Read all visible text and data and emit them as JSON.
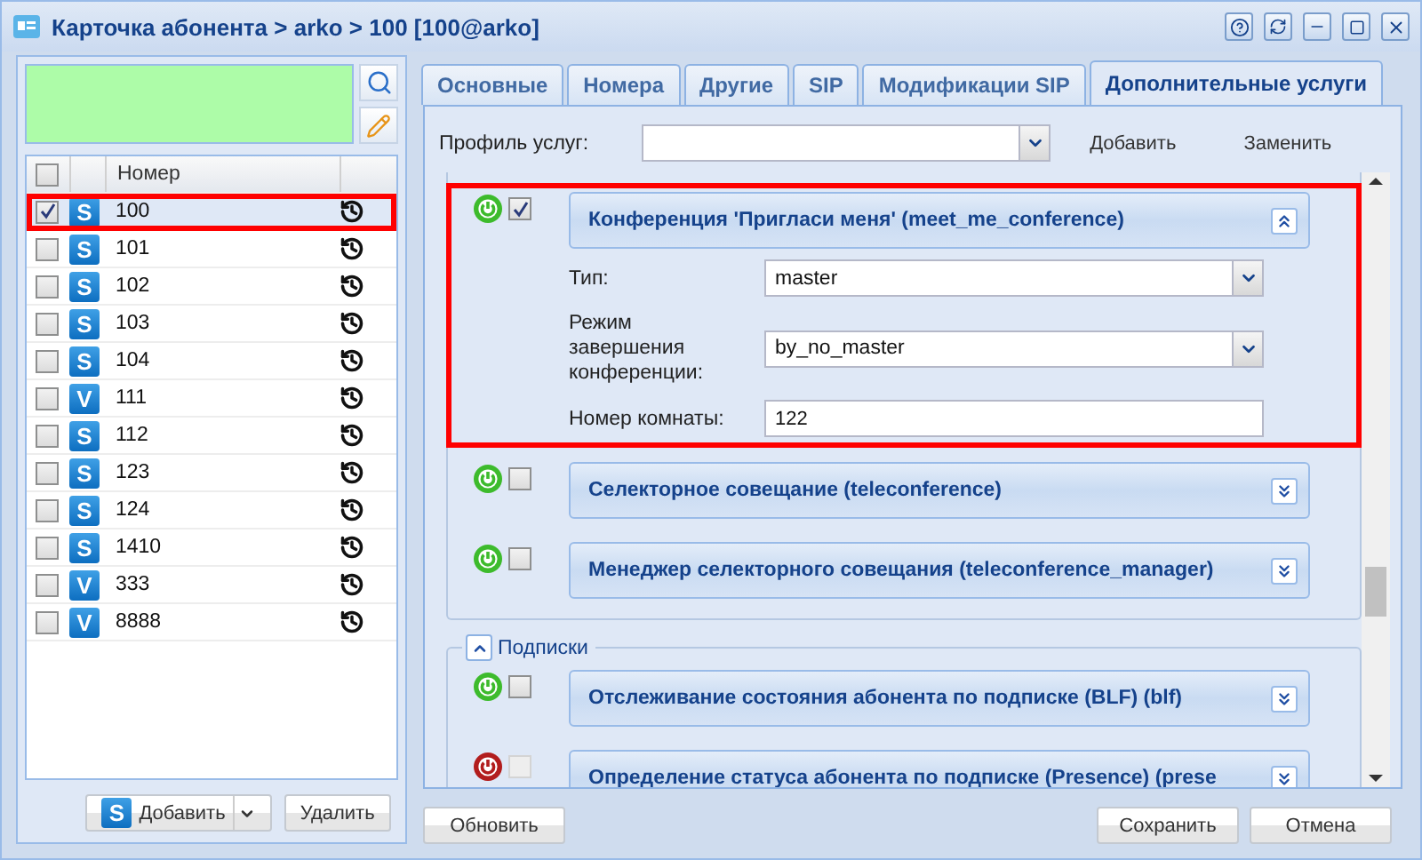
{
  "window": {
    "title": "Карточка абонента > arko > 100 [100@arko]"
  },
  "left": {
    "column": "Номер",
    "all_checked": false,
    "rows": [
      {
        "badge": "S",
        "number": "100",
        "checked": true,
        "highlighted": true
      },
      {
        "badge": "S",
        "number": "101",
        "checked": false,
        "highlighted": false
      },
      {
        "badge": "S",
        "number": "102",
        "checked": false,
        "highlighted": false
      },
      {
        "badge": "S",
        "number": "103",
        "checked": false,
        "highlighted": false
      },
      {
        "badge": "S",
        "number": "104",
        "checked": false,
        "highlighted": false
      },
      {
        "badge": "V",
        "number": "111",
        "checked": false,
        "highlighted": false
      },
      {
        "badge": "S",
        "number": "112",
        "checked": false,
        "highlighted": false
      },
      {
        "badge": "S",
        "number": "123",
        "checked": false,
        "highlighted": false
      },
      {
        "badge": "S",
        "number": "124",
        "checked": false,
        "highlighted": false
      },
      {
        "badge": "S",
        "number": "1410",
        "checked": false,
        "highlighted": false
      },
      {
        "badge": "V",
        "number": "333",
        "checked": false,
        "highlighted": false
      },
      {
        "badge": "V",
        "number": "8888",
        "checked": false,
        "highlighted": false
      }
    ],
    "add_button": {
      "badge": "S",
      "label": "Добавить"
    },
    "delete_button": "Удалить"
  },
  "tabs": [
    {
      "label": "Основные",
      "selected": false
    },
    {
      "label": "Номера",
      "selected": false
    },
    {
      "label": "Другие",
      "selected": false
    },
    {
      "label": "SIP",
      "selected": false
    },
    {
      "label": "Модификации SIP",
      "selected": false
    },
    {
      "label": "Дополнительные услуги",
      "selected": true
    }
  ],
  "profile": {
    "label": "Профиль услуг:",
    "actions": [
      "Добавить",
      "Заменить"
    ]
  },
  "groups": [
    {
      "services": [
        {
          "title": "Конференция 'Пригласи меня' (meet_me_conference)",
          "active": true,
          "checked": true,
          "disabled": false,
          "expanded": true,
          "highlighted": true,
          "fields": [
            {
              "kind": "select",
              "label": "Тип:",
              "value": "master"
            },
            {
              "kind": "select",
              "label": "Режим завершения конференции:",
              "value": "by_no_master"
            },
            {
              "kind": "text",
              "label": "Номер комнаты:",
              "value": "122"
            }
          ]
        },
        {
          "title": "Селекторное совещание (teleconference)",
          "active": true,
          "checked": false,
          "disabled": false,
          "expanded": false,
          "highlighted": false
        },
        {
          "title": "Менеджер селекторного совещания (teleconference_manager)",
          "active": true,
          "checked": false,
          "disabled": false,
          "expanded": false,
          "highlighted": false
        }
      ]
    },
    {
      "legend": "Подписки",
      "expanded": true,
      "services": [
        {
          "title": "Отслеживание состояния абонента по подписке (BLF) (blf)",
          "active": true,
          "checked": false,
          "disabled": false,
          "expanded": false,
          "highlighted": false
        },
        {
          "title": "Определение статуса абонента по подписке (Presence) (prese",
          "active": false,
          "checked": false,
          "disabled": true,
          "expanded": false,
          "highlighted": false
        }
      ]
    }
  ],
  "footer": {
    "refresh": "Обновить",
    "save": "Сохранить",
    "cancel": "Отмена"
  }
}
